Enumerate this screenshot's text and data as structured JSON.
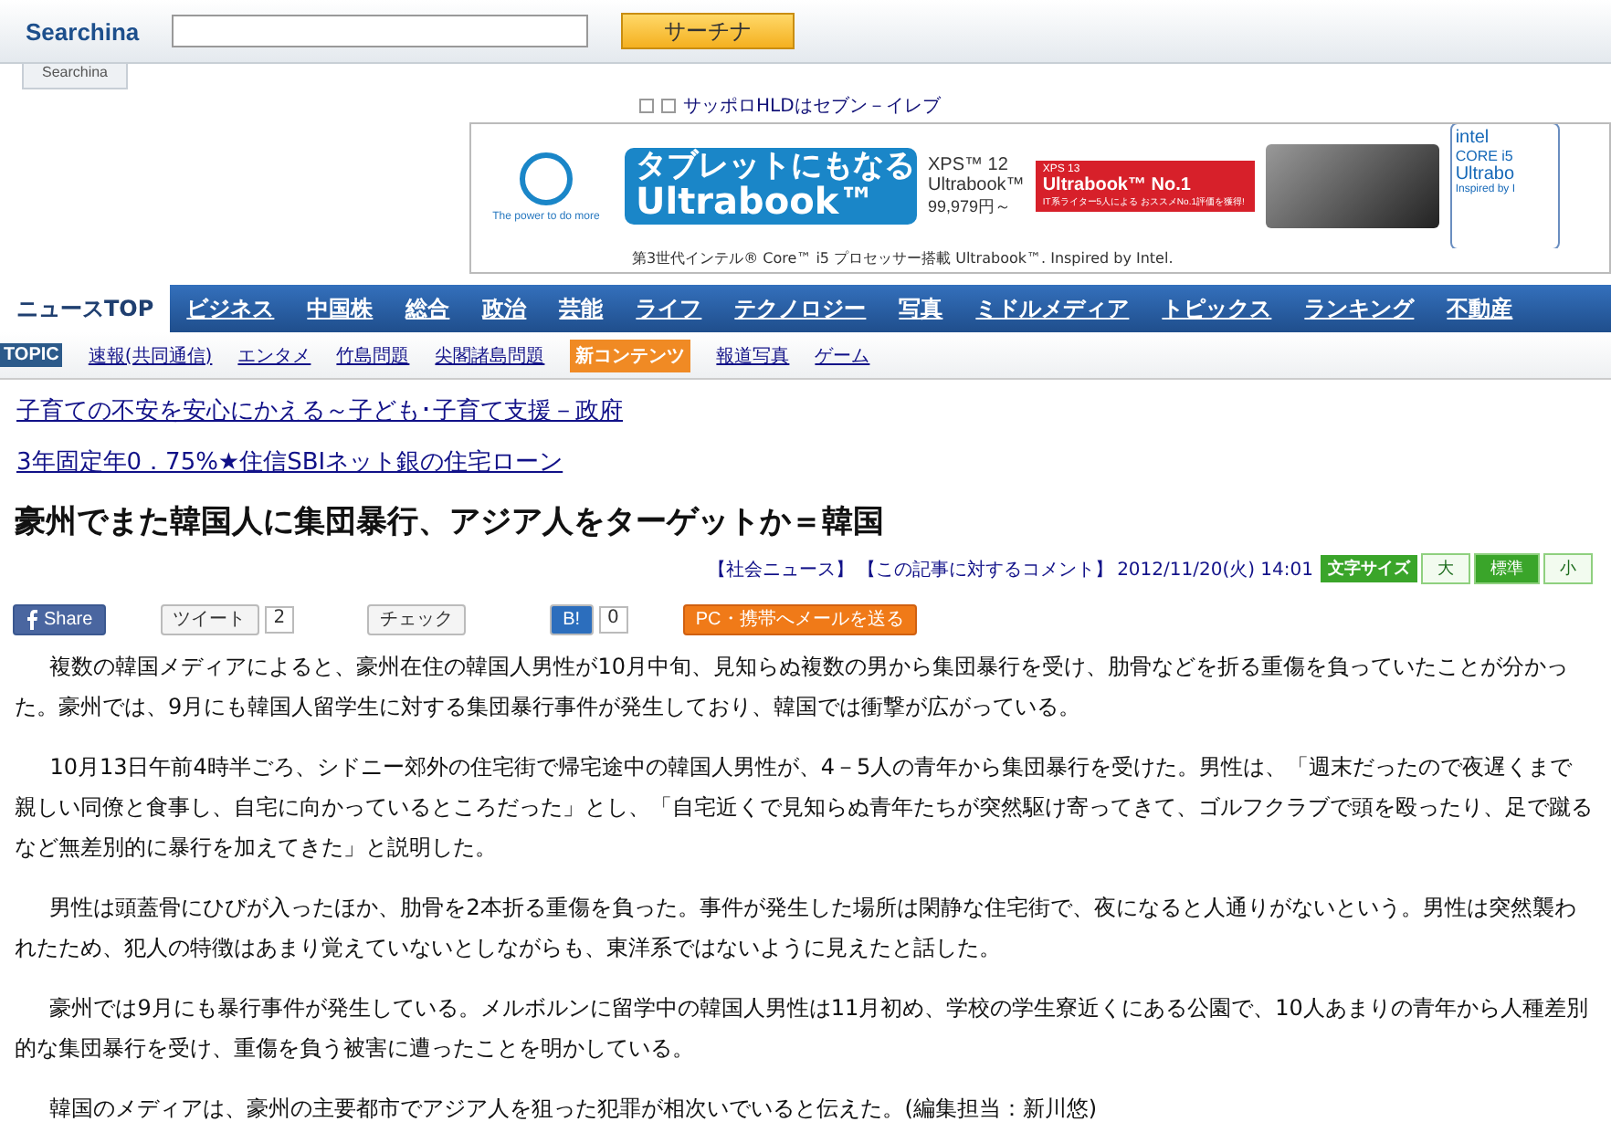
{
  "header": {
    "logo": "Searchina",
    "logo_tab": "Searchina",
    "search_button": "サーチナ"
  },
  "ticker": {
    "text": "サッポロHLDはセブン－イレブ"
  },
  "ad": {
    "brand_tagline": "The power to do more",
    "headline_1": "タブレットにもなる",
    "headline_2": "Ultrabook™",
    "model_1": "XPS™ 12",
    "model_2": "Ultrabook™",
    "price": "99,979円～",
    "award_tag": "XPS 13",
    "award_title": "Ultrabook™ No.1",
    "award_sub": "IT系ライター5人による おススメNo.1評価を獲得!",
    "footer": "第3世代インテル® Core™ i5 プロセッサー搭載 Ultrabook™. Inspired by Intel.",
    "intel_brand": "intel",
    "intel_core": "CORE i5",
    "intel_line": "Ultrabo",
    "intel_tag": "Inspired by I"
  },
  "nav": [
    {
      "label": "ニュースTOP",
      "selected": true
    },
    {
      "label": "ビジネス",
      "selected": false
    },
    {
      "label": "中国株",
      "selected": false
    },
    {
      "label": "総合",
      "selected": false
    },
    {
      "label": "政治",
      "selected": false
    },
    {
      "label": "芸能",
      "selected": false
    },
    {
      "label": "ライフ",
      "selected": false
    },
    {
      "label": "テクノロジー",
      "selected": false
    },
    {
      "label": "写真",
      "selected": false
    },
    {
      "label": "ミドルメディア",
      "selected": false
    },
    {
      "label": "トピックス",
      "selected": false
    },
    {
      "label": "ランキング",
      "selected": false
    },
    {
      "label": "不動産",
      "selected": false
    }
  ],
  "topic_bar": {
    "badge": "TOPIC",
    "items": [
      {
        "label": "速報(共同通信)",
        "kind": "link"
      },
      {
        "label": "エンタメ",
        "kind": "link"
      },
      {
        "label": "竹島問題",
        "kind": "link"
      },
      {
        "label": "尖閣諸島問題",
        "kind": "link"
      },
      {
        "label": "新コンテンツ",
        "kind": "badge"
      },
      {
        "label": "報道写真",
        "kind": "link"
      },
      {
        "label": "ゲーム",
        "kind": "link"
      }
    ]
  },
  "promo_links": [
    "子育ての不安を安心にかえる～子ども･子育て支援－政府",
    "3年固定年0．75%★住信SBIネット銀の住宅ローン"
  ],
  "article": {
    "title": "豪州でまた韓国人に集団暴行、アジア人をターゲットか＝韓国",
    "category": "【社会ニュース】",
    "comment_link": "【この記事に対するコメント】",
    "date": "2012/11/20(火) 14:01",
    "font_size": {
      "label": "文字サイズ",
      "options": [
        {
          "label": "大",
          "selected": false
        },
        {
          "label": "標準",
          "selected": true
        },
        {
          "label": "小",
          "selected": false
        }
      ]
    },
    "share": {
      "facebook": "Share",
      "tweet": "ツイート",
      "tweet_count": "2",
      "check": "チェック",
      "hatena": "B!",
      "hatena_count": "0",
      "mail": "PC・携帯へメールを送る"
    },
    "paragraphs": [
      "複数の韓国メディアによると、豪州在住の韓国人男性が10月中旬、見知らぬ複数の男から集団暴行を受け、肋骨などを折る重傷を負っていたことが分かった。豪州では、9月にも韓国人留学生に対する集団暴行事件が発生しており、韓国では衝撃が広がっている。",
      "10月13日午前4時半ごろ、シドニー郊外の住宅街で帰宅途中の韓国人男性が、4－5人の青年から集団暴行を受けた。男性は、「週末だったので夜遅くまで親しい同僚と食事し、自宅に向かっているところだった」とし、「自宅近くで見知らぬ青年たちが突然駆け寄ってきて、ゴルフクラブで頭を殴ったり、足で蹴るなど無差別的に暴行を加えてきた」と説明した。",
      "男性は頭蓋骨にひびが入ったほか、肋骨を2本折る重傷を負った。事件が発生した場所は閑静な住宅街で、夜になると人通りがないという。男性は突然襲われたため、犯人の特徴はあまり覚えていないとしながらも、東洋系ではないように見えたと話した。",
      "豪州では9月にも暴行事件が発生している。メルボルンに留学中の韓国人男性は11月初め、学校の学生寮近くにある公園で、10人あまりの青年から人種差別的な集団暴行を受け、重傷を負う被害に遭ったことを明かしている。",
      "韓国のメディアは、豪州の主要都市でアジア人を狙った犯罪が相次いでいると伝えた。(編集担当：新川悠)"
    ]
  }
}
